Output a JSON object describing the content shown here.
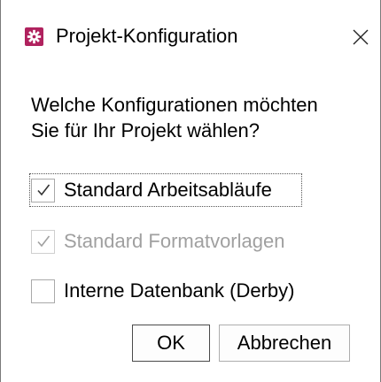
{
  "window": {
    "title": "Projekt-Konfiguration",
    "app_icon": "gear-icon",
    "app_icon_color": "#b0225e",
    "close_icon": "close-icon"
  },
  "question": {
    "line1": "Welche Konfigurationen möchten",
    "line2": "Sie für Ihr Projekt wählen?"
  },
  "options": [
    {
      "label": "Standard Arbeitsabläufe",
      "checked": true,
      "enabled": true,
      "focused": true
    },
    {
      "label": "Standard Formatvorlagen",
      "checked": true,
      "enabled": false,
      "focused": false
    },
    {
      "label": "Interne Datenbank (Derby)",
      "checked": false,
      "enabled": true,
      "focused": false
    }
  ],
  "buttons": {
    "ok": "OK",
    "cancel": "Abbrechen"
  }
}
